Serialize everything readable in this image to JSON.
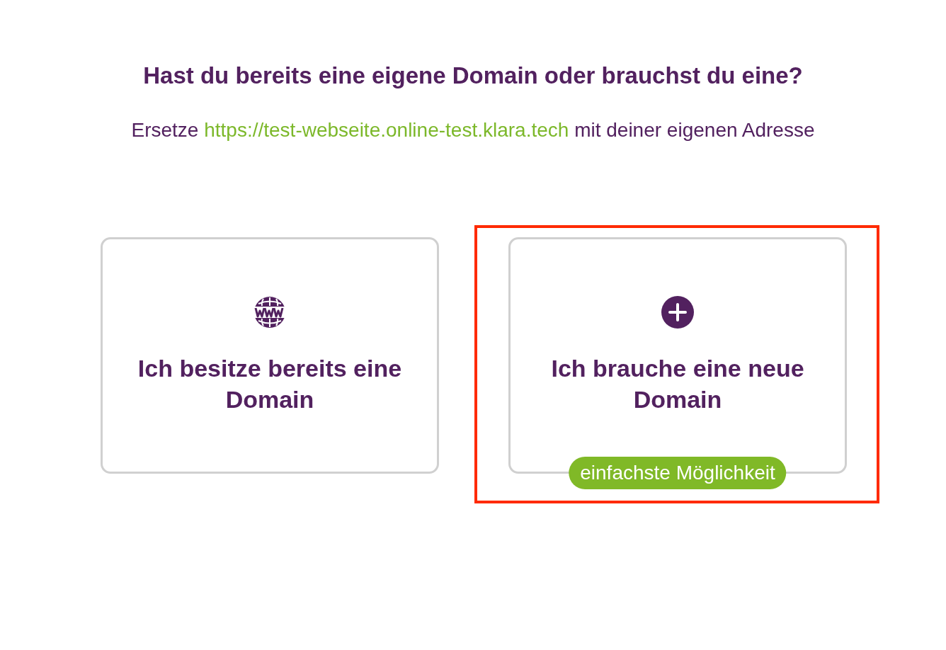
{
  "heading": "Hast du bereits eine eigene Domain oder brauchst du eine?",
  "instruction": {
    "before": "Ersetze",
    "link": "https://test-webseite.online-test.klara.tech",
    "after": "mit deiner eigenen Adresse"
  },
  "options": [
    {
      "kind": "globe",
      "title": "Ich besitze bereits eine Domain",
      "highlighted": false
    },
    {
      "kind": "plus",
      "title": "Ich brauche eine neue Domain",
      "highlighted": true,
      "badge": "einfachste Möglichkeit"
    }
  ]
}
